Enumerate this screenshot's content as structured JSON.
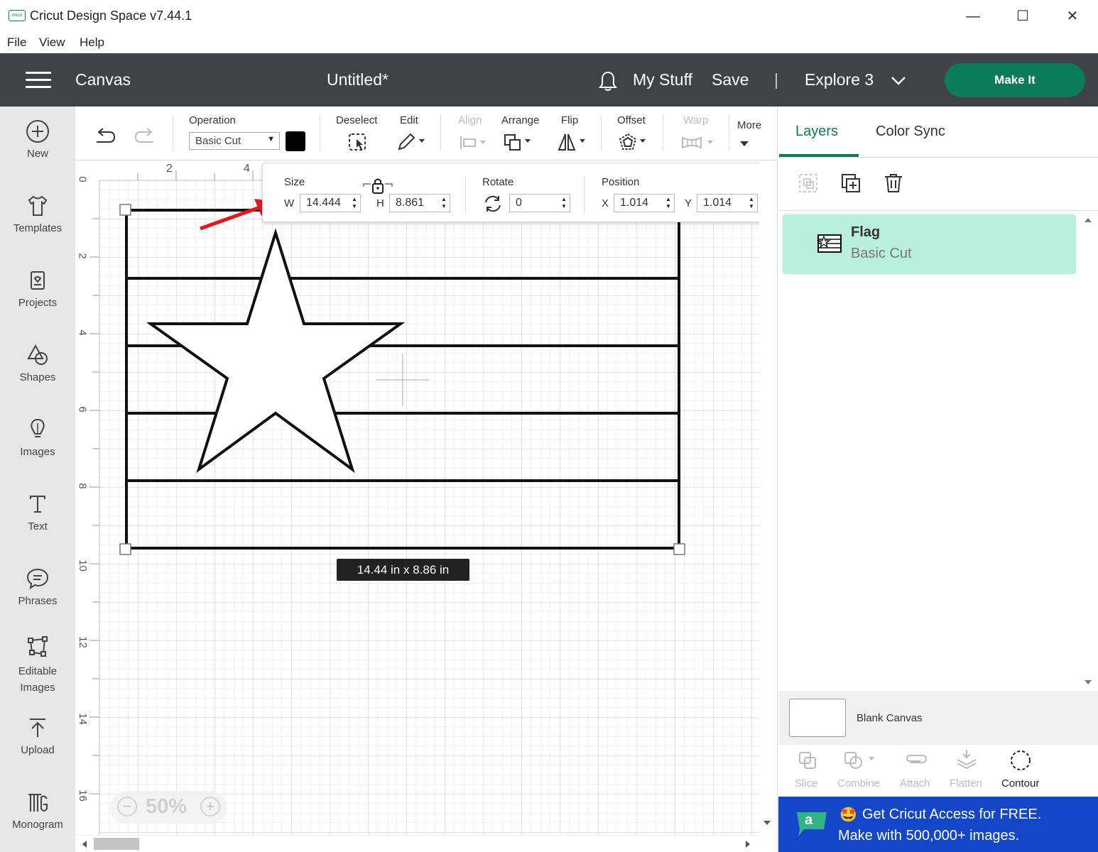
{
  "window": {
    "title": "Cricut Design Space  v7.44.1",
    "logo_text": "cricut",
    "controls": [
      "—",
      "☐",
      "✕"
    ]
  },
  "menu": [
    "File",
    "View",
    "Help"
  ],
  "header": {
    "canvas_label": "Canvas",
    "doc_title": "Untitled*",
    "my_stuff": "My Stuff",
    "save": "Save",
    "divider": "|",
    "machine": "Explore 3",
    "make_it": "Make It"
  },
  "sidebar": [
    {
      "label": "New",
      "icon": "plus-circle-icon"
    },
    {
      "label": "Templates",
      "icon": "tshirt-icon"
    },
    {
      "label": "Projects",
      "icon": "projects-icon"
    },
    {
      "label": "Shapes",
      "icon": "shapes-icon"
    },
    {
      "label": "Images",
      "icon": "lightbulb-icon"
    },
    {
      "label": "Text",
      "icon": "text-icon"
    },
    {
      "label": "Phrases",
      "icon": "speech-bubble-icon"
    },
    {
      "label": "Editable",
      "label2": "Images",
      "icon": "editable-images-icon"
    },
    {
      "label": "Upload",
      "icon": "upload-icon"
    },
    {
      "label": "Monogram",
      "icon": "monogram-icon"
    }
  ],
  "toolbar": {
    "operation_label": "Operation",
    "operation_value": "Basic Cut",
    "swatch_color": "#000000",
    "deselect": "Deselect",
    "edit": "Edit",
    "align": "Align",
    "arrange": "Arrange",
    "flip": "Flip",
    "offset": "Offset",
    "warp": "Warp",
    "more": "More"
  },
  "size_popup": {
    "size_label": "Size",
    "w_label": "W",
    "w_value": "14.444",
    "h_label": "H",
    "h_value": "8.861",
    "rotate_label": "Rotate",
    "rotate_value": "0",
    "position_label": "Position",
    "x_label": "X",
    "x_value": "1.014",
    "y_label": "Y",
    "y_value": "1.014"
  },
  "canvas": {
    "ruler_top": [
      "2",
      "4"
    ],
    "ruler_left": [
      "0",
      "2",
      "4",
      "6",
      "8",
      "10",
      "12",
      "14",
      "16"
    ],
    "dims_tooltip": "14.44  in x 8.86  in",
    "zoom_minus": "−",
    "zoom": "50%",
    "zoom_plus": "+"
  },
  "right_panel": {
    "tab_layers": "Layers",
    "tab_color_sync": "Color Sync",
    "layer_name": "Flag",
    "layer_op": "Basic Cut",
    "blank_canvas": "Blank Canvas",
    "bottom_tools": [
      "Slice",
      "Combine",
      "Attach",
      "Flatten",
      "Contour"
    ],
    "promo_line1": "Get Cricut Access for FREE.",
    "promo_line2": "Make with 500,000+ images.",
    "promo_logo": "a",
    "promo_emoji": "🤩",
    "accent": "#0c7b57",
    "layer_bg": "#b9efdd",
    "promo_bg": "#1346c8"
  }
}
